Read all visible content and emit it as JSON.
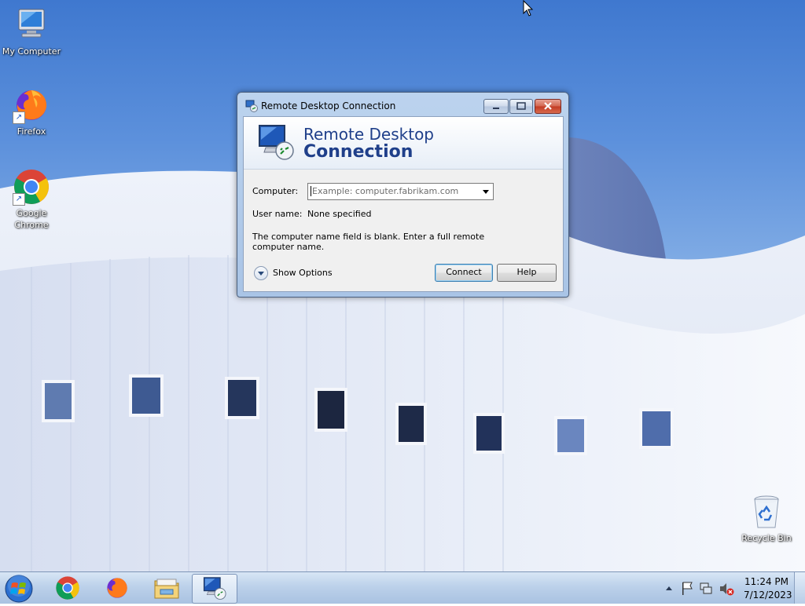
{
  "desktop": {
    "icons": [
      {
        "label": "My Computer",
        "icon": "computer-icon"
      },
      {
        "label": "Firefox",
        "icon": "firefox-icon"
      },
      {
        "label": "Google Chrome",
        "icon": "chrome-icon"
      },
      {
        "label": "Recycle Bin",
        "icon": "recycle-bin-icon"
      }
    ]
  },
  "window": {
    "title": "Remote Desktop Connection",
    "banner_line1": "Remote Desktop",
    "banner_line2": "Connection",
    "computer_label": "Computer:",
    "computer_placeholder": "Example: computer.fabrikam.com",
    "username_label": "User name:",
    "username_value": "None specified",
    "message": "The computer name field is blank. Enter a full remote computer name.",
    "show_options_label": "Show Options",
    "connect_label": "Connect",
    "help_label": "Help"
  },
  "taskbar": {
    "pinned": [
      "chrome-icon",
      "firefox-icon",
      "file-explorer-icon",
      "remote-desktop-icon"
    ],
    "clock_time": "11:24 PM",
    "clock_date": "7/12/2023",
    "tray_icons": [
      "show-hidden-icons-arrow",
      "action-center-flag-icon",
      "network-icon",
      "volume-muted-icon"
    ]
  },
  "colors": {
    "banner_text": "#1f3f8a",
    "close_button": "#c23a22",
    "taskbar": "#bcd1ea"
  }
}
